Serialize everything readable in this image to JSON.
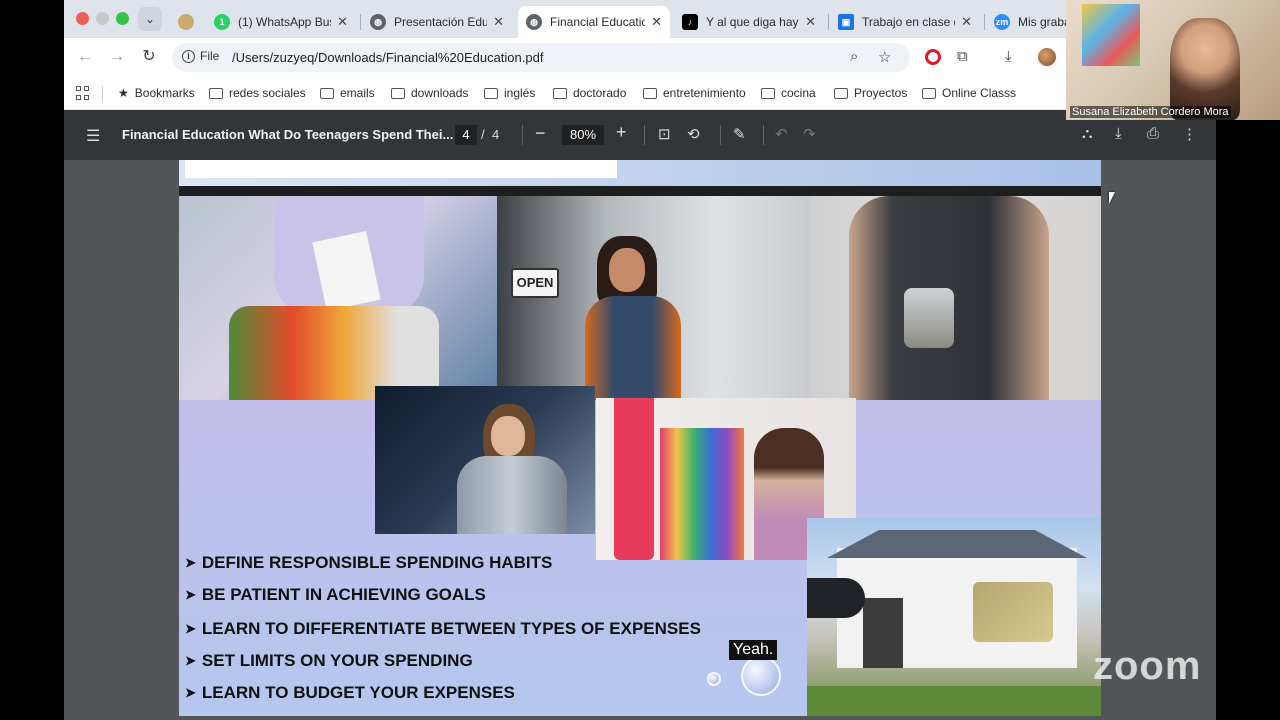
{
  "browser": {
    "tabs": [
      {
        "title": "(1) WhatsApp Bus",
        "icon": "whatsapp-icon",
        "color": "#25d366"
      },
      {
        "title": "Presentación Edu",
        "icon": "globe-icon",
        "color": "#5f6368"
      },
      {
        "title": "Financial Educatio",
        "icon": "globe-icon",
        "color": "#5f6368",
        "active": true
      },
      {
        "title": "Y al que diga hay",
        "icon": "tiktok-icon",
        "color": "#000000"
      },
      {
        "title": "Trabajo en clase d",
        "icon": "classroom-icon",
        "color": "#1a73e8"
      },
      {
        "title": "Mis graba",
        "icon": "zoom-icon",
        "color": "#2d8cff"
      }
    ],
    "omnibox": {
      "chip": "File",
      "url": "/Users/zuzyeq/Downloads/Financial%20Education.pdf"
    },
    "bookmarks": [
      "Bookmarks",
      "redes sociales",
      "emails",
      "downloads",
      "inglés",
      "doctorado",
      "entretenimiento",
      "cocina",
      "Proyectos",
      "Online Classs"
    ]
  },
  "pdf_viewer": {
    "title": "Financial Education What Do Teenagers Spend Thei...",
    "page_current": "4",
    "page_separator": "/",
    "page_total": "4",
    "zoom": "80%"
  },
  "slide": {
    "open_sign": "OPEN",
    "bullets": [
      "DEFINE RESPONSIBLE SPENDING HABITS",
      "BE PATIENT IN ACHIEVING GOALS",
      "LEARN TO DIFFERENTIATE BETWEEN TYPES OF EXPENSES",
      "SET LIMITS ON YOUR SPENDING",
      "LEARN TO BUDGET YOUR EXPENSES"
    ]
  },
  "caption": "Yeah.",
  "webcam": {
    "participant_name": "Susana Elizabeth Cordero Mora"
  },
  "watermark": "zoom"
}
